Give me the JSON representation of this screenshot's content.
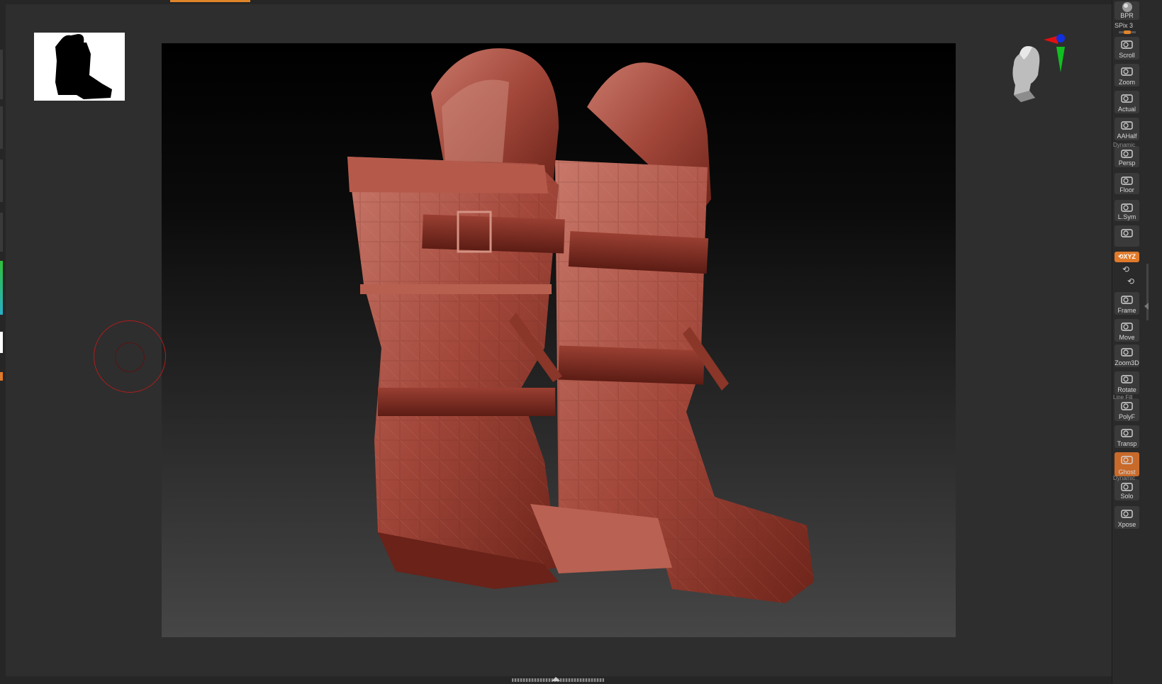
{
  "viewport": {
    "model_icon": "boots-model",
    "background_gradient": [
      "#000000",
      "#464646"
    ],
    "material_color": "#9a3a2a"
  },
  "brush": {
    "icon": "brush-circle-icon",
    "color": "#b01c1c"
  },
  "navigation_gizmo": {
    "icon": "head-orientation-icon",
    "axis_colors": {
      "x": "#e01010",
      "y": "#10c020",
      "z": "#1030e0"
    }
  },
  "shelf": {
    "bpr_label": "BPR",
    "spix_label": "SPix 3",
    "items": [
      {
        "label": "Scroll",
        "icon": "hand-scroll-icon"
      },
      {
        "label": "Zoom",
        "icon": "zoom-icon"
      },
      {
        "label": "Actual",
        "icon": "zoom-actual-icon"
      },
      {
        "label": "AAHalf",
        "icon": "zoom-aahalf-icon"
      },
      {
        "label": "Persp",
        "icon": "perspective-icon",
        "top_text": "Dynamic"
      },
      {
        "label": "Floor",
        "icon": "floor-grid-icon"
      },
      {
        "label": "L.Sym",
        "icon": "local-symmetry-icon"
      },
      {
        "label": "",
        "icon": "lock-camera-icon"
      },
      {
        "label": "Frame",
        "icon": "frame-icon"
      },
      {
        "label": "Move",
        "icon": "move-icon"
      },
      {
        "label": "Zoom3D",
        "icon": "zoom3d-icon"
      },
      {
        "label": "Rotate",
        "icon": "rotate-icon"
      },
      {
        "label": "PolyF",
        "icon": "polyframe-icon",
        "top_text": "Line Fill"
      },
      {
        "label": "Transp",
        "icon": "transparency-icon"
      },
      {
        "label": "Ghost",
        "icon": "ghost-icon",
        "active": true
      },
      {
        "label": "Solo",
        "icon": "solo-icon",
        "top_text": "Dynamic"
      },
      {
        "label": "Xpose",
        "icon": "xpose-icon"
      }
    ],
    "xyz_label": "⟲XYZ",
    "accent_color": "#e07a2a"
  }
}
